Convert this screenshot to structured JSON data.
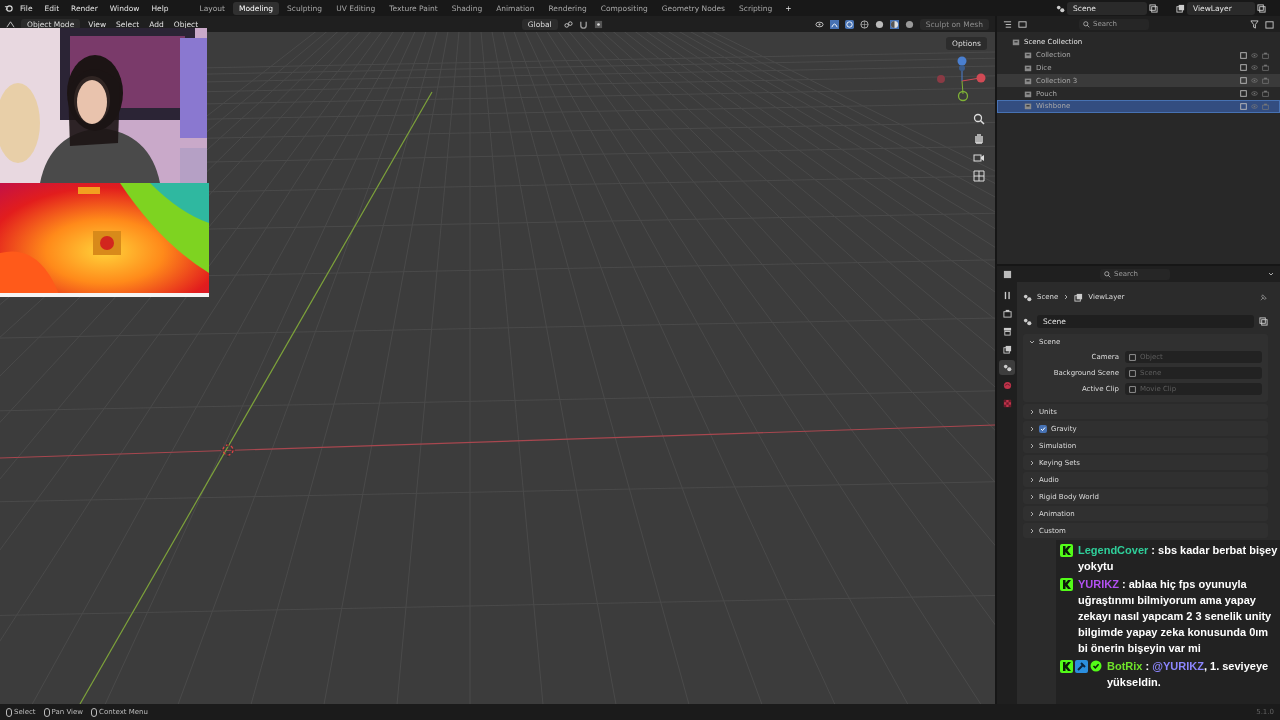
{
  "menu": [
    "File",
    "Edit",
    "Render",
    "Window",
    "Help"
  ],
  "workspaces": [
    {
      "label": "Layout",
      "selected": false
    },
    {
      "label": "Modeling",
      "selected": true
    },
    {
      "label": "Sculpting",
      "selected": false
    },
    {
      "label": "UV Editing",
      "selected": false
    },
    {
      "label": "Texture Paint",
      "selected": false
    },
    {
      "label": "Shading",
      "selected": false
    },
    {
      "label": "Animation",
      "selected": false
    },
    {
      "label": "Rendering",
      "selected": false
    },
    {
      "label": "Compositing",
      "selected": false
    },
    {
      "label": "Geometry Nodes",
      "selected": false
    },
    {
      "label": "Scripting",
      "selected": false
    }
  ],
  "add_workspace": "+",
  "scene_field": "Scene",
  "view_layer_field": "ViewLayer",
  "viewport": {
    "mode": "Object Mode",
    "menus": [
      "View",
      "Select",
      "Add",
      "Object"
    ],
    "orientation": "Global",
    "sculpt_button": {
      "label": "Sculpt on Mesh",
      "disabled": true
    },
    "options": "Options"
  },
  "outliner": {
    "search_placeholder": "Search",
    "root": "Scene Collection",
    "children": [
      {
        "label": "Collection",
        "selected": false,
        "highlighted": false
      },
      {
        "label": "Dice",
        "selected": false,
        "highlighted": false
      },
      {
        "label": "Collection 3",
        "selected": false,
        "highlighted": true
      },
      {
        "label": "Pouch",
        "selected": false,
        "highlighted": false
      },
      {
        "label": "Wishbone",
        "selected": true,
        "highlighted": false
      }
    ]
  },
  "properties": {
    "search_placeholder": "Search",
    "tabs": [
      {
        "kind": "tool",
        "selected": false
      },
      {
        "kind": "render",
        "selected": false
      },
      {
        "kind": "output",
        "selected": false
      },
      {
        "kind": "view_layer",
        "selected": false
      },
      {
        "kind": "scene",
        "selected": true
      },
      {
        "kind": "world",
        "selected": false
      },
      {
        "kind": "texture",
        "selected": false
      }
    ],
    "breadcrumb": [
      "Scene",
      "ViewLayer"
    ],
    "scene_selector": "Scene",
    "panels": [
      {
        "title": "Scene",
        "kind": "plain",
        "expanded": true,
        "fields": [
          {
            "label": "Camera",
            "placeholder": "Object"
          },
          {
            "label": "Background Scene",
            "placeholder": "Scene"
          },
          {
            "label": "Active Clip",
            "placeholder": "Movie Clip"
          }
        ]
      },
      {
        "title": "Units",
        "kind": "plain",
        "expanded": false
      },
      {
        "title": "Gravity",
        "kind": "toggle",
        "expanded": false,
        "checked": true
      },
      {
        "title": "Simulation",
        "kind": "plain",
        "expanded": false
      },
      {
        "title": "Keying Sets",
        "kind": "plain",
        "expanded": false
      },
      {
        "title": "Audio",
        "kind": "plain",
        "expanded": false
      },
      {
        "title": "Rigid Body World",
        "kind": "plain",
        "expanded": false
      },
      {
        "title": "Animation",
        "kind": "plain",
        "expanded": false
      },
      {
        "title": "Custom",
        "kind": "plain",
        "expanded": false
      }
    ]
  },
  "chat": [
    {
      "badges": [
        {
          "kind": "sub"
        }
      ],
      "user": "LegendCover",
      "color": "#2fcf9a",
      "separator": ":",
      "text": "sbs kadar berbat bişey yokytu"
    },
    {
      "badges": [
        {
          "kind": "sub"
        }
      ],
      "user": "YURIKZ",
      "color": "#b251f2",
      "separator": ":",
      "text": "ablaa hiç fps oyunuyla uğraştınmı bilmiyorum ama yapay zekayı nasıl yapcam 2 3 senelik unity bilgimde yapay zeka konusunda 0ım bi önerin bişeyin var mi"
    },
    {
      "badges": [
        {
          "kind": "sub"
        },
        {
          "kind": "mod"
        },
        {
          "kind": "verified"
        }
      ],
      "user": "BotRix",
      "color": "#6fe22a",
      "separator": ":",
      "mention": "@YURIKZ",
      "text": ", 1. seviyeye yükseldin."
    }
  ],
  "status_bar": {
    "hints": [
      "Select",
      "Pan View",
      "Context Menu"
    ],
    "version": "5.1.0"
  }
}
